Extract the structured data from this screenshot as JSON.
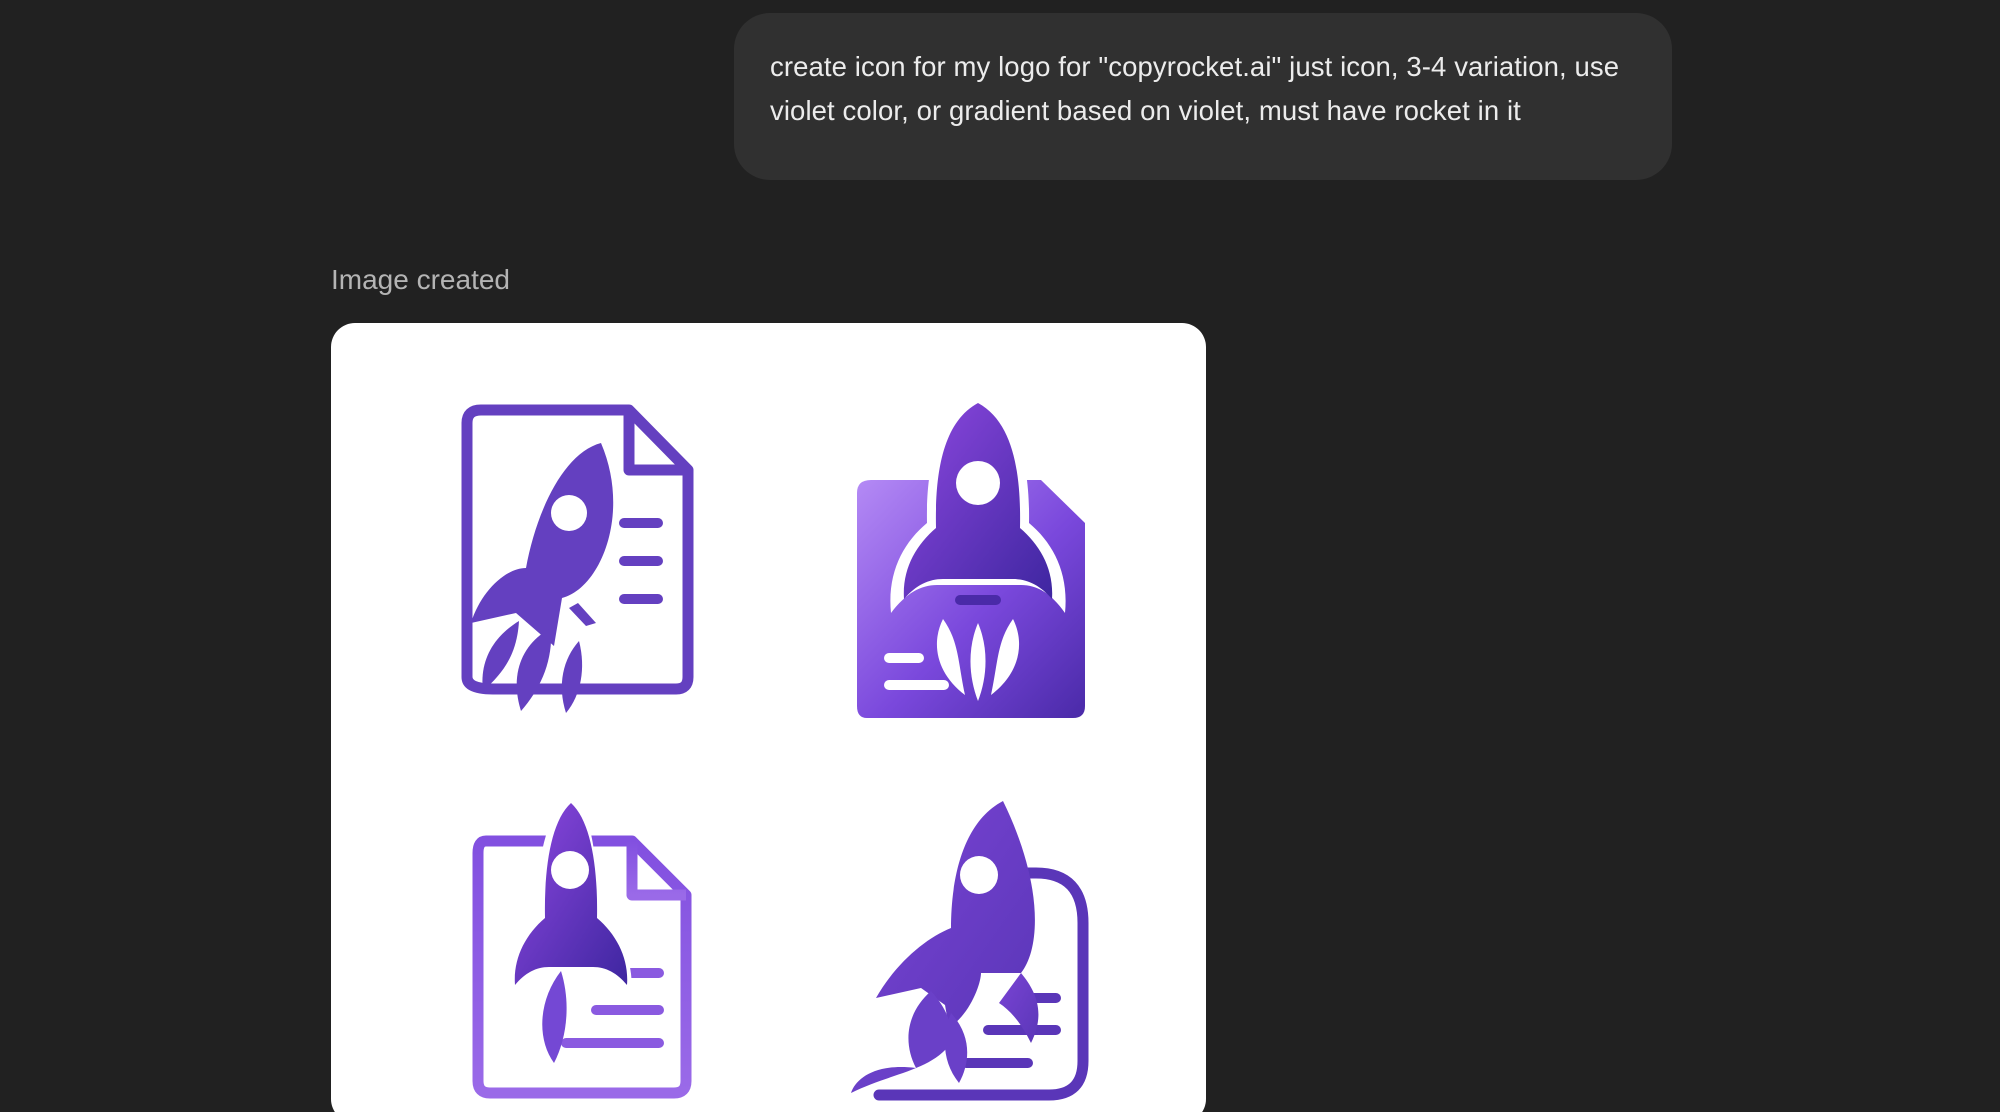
{
  "conversation": {
    "user_message": "create icon for my logo for \"copyrocket.ai\" just icon, 3-4 variation, use violet color, or gradient based on violet, must have rocket in it",
    "assistant_status": "Image created"
  },
  "generated_image": {
    "subject": "four violet rocket document logo icon variations",
    "colors": {
      "background": "#ffffff",
      "violet_main": "#6440c0",
      "violet_light": "#b07ef0",
      "violet_dark": "#4a2aa8",
      "violet_mid": "#8a4ee0"
    }
  },
  "theme": {
    "page_background": "#212121",
    "bubble_background": "#303030",
    "text_primary": "#ececec",
    "text_secondary": "#b4b4b4"
  }
}
